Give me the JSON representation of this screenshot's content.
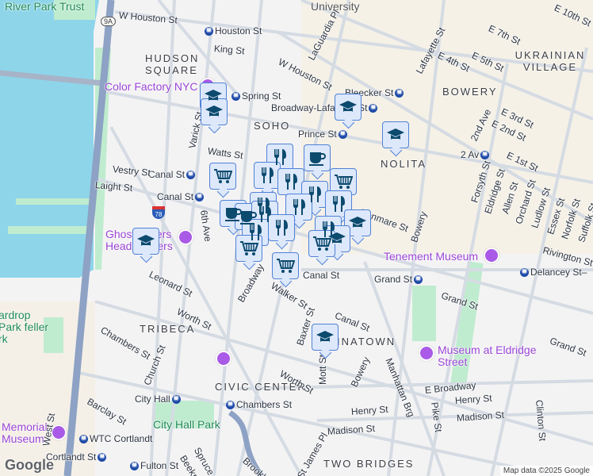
{
  "map": {
    "attribution": "Map data ©2025 Google",
    "logo": "Google",
    "colors": {
      "water": "#8ed5ea",
      "park": "#bfeccf",
      "highway": "#8da2c4",
      "road": "#d5dbe3",
      "marker_bg": "#dde8fb",
      "marker_border": "#4f82d6",
      "marker_icon": "#0c4a6e",
      "poi": "#9a45d6"
    },
    "highway_badges": {
      "route_9a": "9A",
      "i78": "78"
    },
    "neighborhoods": [
      "HUDSON SQUARE",
      "SOHO",
      "BOWERY",
      "UKRAINIAN VILLAGE",
      "NOLITA",
      "TRIBECA",
      "CIVIC CENTER",
      "INATOWN",
      "TWO BRIDGES"
    ],
    "pois": [
      "Color Factory NYC",
      "Ghostbusters Headquarters",
      "Tenement Museum",
      "Museum at Eldridge Street",
      "Memorial Museum",
      "River Park Trust",
      "University"
    ],
    "parks": [
      "City Hall Park",
      "ardrop Park feller rk"
    ],
    "stations": [
      "Houston St",
      "Spring St",
      "Broadway-Lafayette St",
      "Bleecker St",
      "Prince St",
      "Canal St",
      "Canal St",
      "2 Av",
      "Grand St",
      "Delancey St–",
      "City Hall",
      "Chambers St",
      "WTC Cortlandt",
      "Cortlandt St",
      "Fulton St"
    ],
    "streets": [
      "W Houston St",
      "King St",
      "W Houston St",
      "LaGuardia Pl",
      "Watts St",
      "Varick St",
      "Vestry St",
      "Laight St",
      "6th Ave",
      "Lafayette St",
      "E 4th St",
      "E 5th St",
      "E 7th St",
      "E 10th St",
      "2nd Ave",
      "E 3rd St",
      "E 2nd St",
      "E 1st St",
      "Forsyth St",
      "Eldridge St",
      "Allen St",
      "Orchard St",
      "Ludlow St",
      "Essex St",
      "Norfolk St",
      "Suffolk St",
      "Kenmare St",
      "Bowery",
      "Rivington St",
      "Grand St",
      "Canal St",
      "Canal St",
      "Grand St",
      "Leonard St",
      "Broadway",
      "Walker St",
      "Worth St",
      "Chambers St",
      "Church St",
      "Baxter St",
      "Mott St",
      "Bowery",
      "Manhattan Brg",
      "Worth St",
      "E Broadway",
      "Henry St",
      "Henry St",
      "Madison St",
      "Madison St",
      "Pike St",
      "Clinton St",
      "St James Pl",
      "Barclay St",
      "West St",
      "Spruce St",
      "Beekman",
      "Brooklyn"
    ],
    "marker_types": [
      "school",
      "cart",
      "cafe",
      "restaurant"
    ]
  }
}
